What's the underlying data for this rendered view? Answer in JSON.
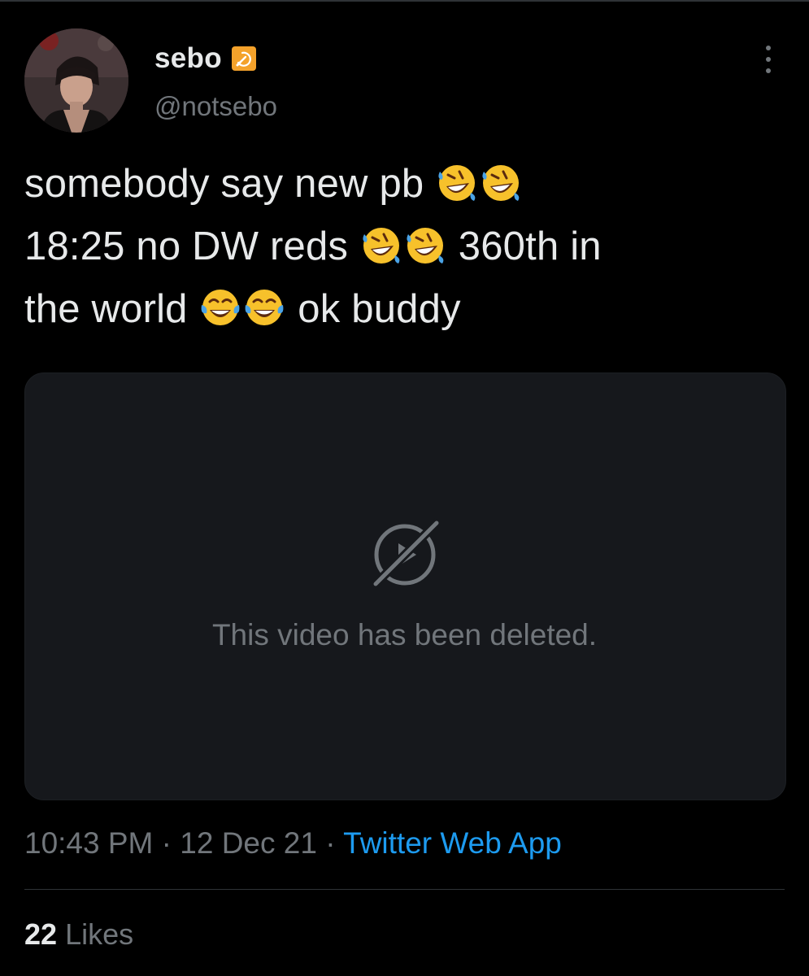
{
  "author": {
    "display_name": "sebo",
    "handle": "@notsebo",
    "badge_icon": "hammer-and-sickle-icon",
    "avatar_icon": "profile-photo"
  },
  "tweet": {
    "line1_text": "somebody say new pb",
    "line2_text_a": "18:25 no DW reds",
    "line2_text_b": "360th in",
    "line3_text_a": "the world",
    "line3_text_b": "ok buddy",
    "emoji": {
      "rofl": "rolling-on-floor-laughing-emoji",
      "joy": "face-with-tears-of-joy-emoji"
    }
  },
  "video": {
    "message": "This video has been deleted.",
    "icon": "video-deleted-icon"
  },
  "meta": {
    "time": "10:43 PM",
    "separator": " · ",
    "date": "12 Dec 21",
    "source": "Twitter Web App"
  },
  "stats": {
    "likes_count": "22",
    "likes_label": "Likes"
  },
  "colors": {
    "background": "#000000",
    "text": "#e7e9ea",
    "muted": "#71767b",
    "link": "#1d9bf0",
    "card": "#16181c",
    "badge": "#f4a22b"
  }
}
